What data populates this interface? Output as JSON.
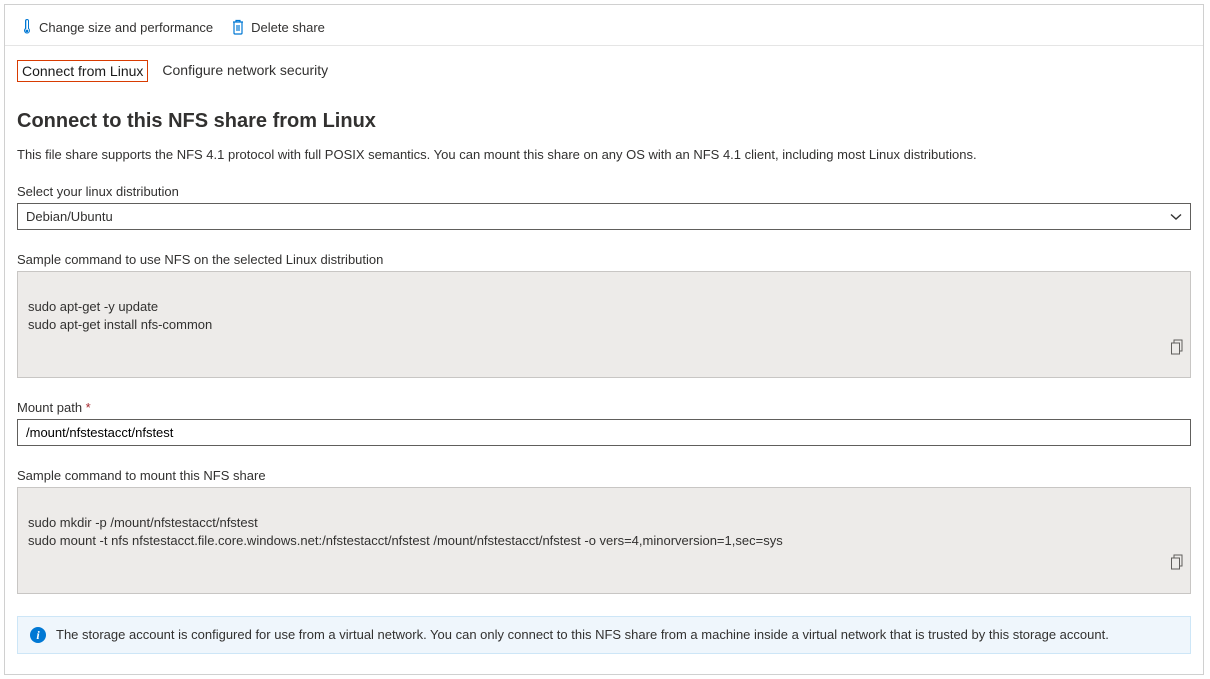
{
  "toolbar": {
    "change_size_label": "Change size and performance",
    "delete_label": "Delete share"
  },
  "tabs": {
    "connect_linux": "Connect from Linux",
    "configure_security": "Configure network security"
  },
  "main": {
    "title": "Connect to this NFS share from Linux",
    "description": "This file share supports the NFS 4.1 protocol with full POSIX semantics. You can mount this share on any OS with an NFS 4.1 client, including most Linux distributions.",
    "distro_label": "Select your linux distribution",
    "distro_value": "Debian/Ubuntu",
    "install_label": "Sample command to use NFS on the selected Linux distribution",
    "install_cmd": "sudo apt-get -y update\nsudo apt-get install nfs-common",
    "mount_path_label": "Mount path",
    "mount_path_value": "/mount/nfstestacct/nfstest",
    "mount_cmd_label": "Sample command to mount this NFS share",
    "mount_cmd": "sudo mkdir -p /mount/nfstestacct/nfstest\nsudo mount -t nfs nfstestacct.file.core.windows.net:/nfstestacct/nfstest /mount/nfstestacct/nfstest -o vers=4,minorversion=1,sec=sys",
    "info_text": "The storage account is configured for use from a virtual network. You can only connect to this NFS share from a machine inside a virtual network that is trusted by this storage account."
  }
}
